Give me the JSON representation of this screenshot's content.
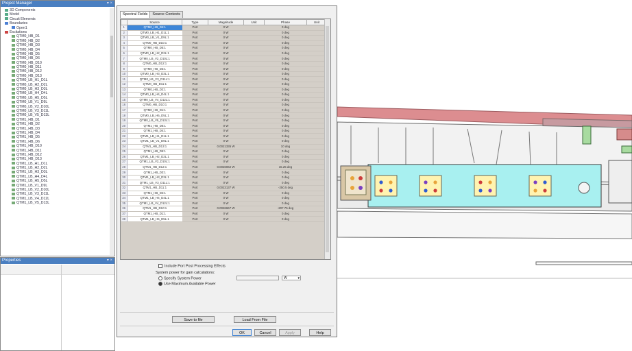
{
  "project_manager": {
    "title": "Project Manager",
    "tree": [
      {
        "label": "3D Components",
        "kind": "comp"
      },
      {
        "label": "Model",
        "kind": "comp"
      },
      {
        "label": "Circuit Elements",
        "kind": "comp"
      },
      {
        "label": "Boundaries",
        "kind": "bnd"
      },
      {
        "label": "Open1",
        "kind": "bnd"
      },
      {
        "label": "Excitations",
        "kind": "exc"
      },
      {
        "label": "QTM0_HB_D1",
        "kind": "port"
      },
      {
        "label": "QTM0_HB_D2",
        "kind": "port"
      },
      {
        "label": "QTM0_HB_D3",
        "kind": "port"
      },
      {
        "label": "QTM0_HB_D4",
        "kind": "port"
      },
      {
        "label": "QTM0_HB_D5",
        "kind": "port"
      },
      {
        "label": "QTM0_HB_D6",
        "kind": "port"
      },
      {
        "label": "QTM0_HB_D10",
        "kind": "port"
      },
      {
        "label": "QTM0_HB_D11",
        "kind": "port"
      },
      {
        "label": "QTM0_HB_D12",
        "kind": "port"
      },
      {
        "label": "QTM0_HB_D13",
        "kind": "port"
      },
      {
        "label": "QTM0_LB_H1_D1L",
        "kind": "port"
      },
      {
        "label": "QTM0_LB_H2_D2L",
        "kind": "port"
      },
      {
        "label": "QTM0_LB_H3_D3L",
        "kind": "port"
      },
      {
        "label": "QTM0_LB_H4_D4L",
        "kind": "port"
      },
      {
        "label": "QTM0_LB_H5_D5L",
        "kind": "port"
      },
      {
        "label": "QTM0_LB_V1_D9L",
        "kind": "port"
      },
      {
        "label": "QTM0_LB_V2_D10L",
        "kind": "port"
      },
      {
        "label": "QTM0_LB_V3_D11L",
        "kind": "port"
      },
      {
        "label": "QTM0_LB_V5_D13L",
        "kind": "port"
      },
      {
        "label": "QTM1_HB_D1",
        "kind": "port"
      },
      {
        "label": "QTM1_HB_D2",
        "kind": "port"
      },
      {
        "label": "QTM1_HB_D3",
        "kind": "port"
      },
      {
        "label": "QTM1_HB_D4",
        "kind": "port"
      },
      {
        "label": "QTM1_HB_D5",
        "kind": "port"
      },
      {
        "label": "QTM1_HB_D6",
        "kind": "port"
      },
      {
        "label": "QTM1_HB_D10",
        "kind": "port"
      },
      {
        "label": "QTM1_HB_D11",
        "kind": "port"
      },
      {
        "label": "QTM1_HB_D12",
        "kind": "port"
      },
      {
        "label": "QTM1_HB_D13",
        "kind": "port"
      },
      {
        "label": "QTM1_LB_H1_D1L",
        "kind": "port"
      },
      {
        "label": "QTM1_LB_H2_D2L",
        "kind": "port"
      },
      {
        "label": "QTM1_LB_H3_D3L",
        "kind": "port"
      },
      {
        "label": "QTM1_LB_H4_D4L",
        "kind": "port"
      },
      {
        "label": "QTM1_LB_H5_D5L",
        "kind": "port"
      },
      {
        "label": "QTM1_LB_V1_D9L",
        "kind": "port"
      },
      {
        "label": "QTM1_LB_V2_D10L",
        "kind": "port"
      },
      {
        "label": "QTM1_LB_V3_D11L",
        "kind": "port"
      },
      {
        "label": "QTM1_LB_V4_D12L",
        "kind": "port"
      },
      {
        "label": "QTM1_LB_V5_D13L",
        "kind": "port"
      }
    ]
  },
  "properties": {
    "title": "Properties"
  },
  "dialog": {
    "tabs": [
      "Spectral Fields",
      "Source Contexts"
    ],
    "columns": [
      "",
      "Source",
      "Type",
      "Magnitude",
      "Unit",
      "Phase",
      "Unit"
    ],
    "rows": [
      {
        "num": "1",
        "source": "QTM0_HB_D4:1",
        "type": "Port",
        "mag": "0 W",
        "phase": "0 deg"
      },
      {
        "num": "2",
        "source": "QTM0_LB_H1_D1L:1",
        "type": "Port",
        "mag": "0 W",
        "phase": "0 deg"
      },
      {
        "num": "3",
        "source": "QTM0_LB_V1_D9L:1",
        "type": "Port",
        "mag": "0 W",
        "phase": "0 deg"
      },
      {
        "num": "4",
        "source": "QTM0_HB_D10:1",
        "type": "Port",
        "mag": "0 W",
        "phase": "0 deg"
      },
      {
        "num": "5",
        "source": "QTM0_HB_D5:1",
        "type": "Port",
        "mag": "0 W",
        "phase": "0 deg"
      },
      {
        "num": "6",
        "source": "QTM0_LB_H2_D2L:1",
        "type": "Port",
        "mag": "0 W",
        "phase": "0 deg"
      },
      {
        "num": "7",
        "source": "QTM0_LB_V2_D10L:1",
        "type": "Port",
        "mag": "0 W",
        "phase": "0 deg"
      },
      {
        "num": "8",
        "source": "QTM0_HB_D12:1",
        "type": "Port",
        "mag": "0 W",
        "phase": "0 deg"
      },
      {
        "num": "9",
        "source": "QTM0_HB_D3:1",
        "type": "Port",
        "mag": "0 W",
        "phase": "0 deg"
      },
      {
        "num": "10",
        "source": "QTM0_LB_H3_D3L:1",
        "type": "Port",
        "mag": "0 W",
        "phase": "0 deg"
      },
      {
        "num": "11",
        "source": "QTM0_LB_V3_D11L:1",
        "type": "Port",
        "mag": "0 W",
        "phase": "0 deg"
      },
      {
        "num": "12",
        "source": "QTM0_HB_D11:1",
        "type": "Port",
        "mag": "0 W",
        "phase": "0 deg"
      },
      {
        "num": "13",
        "source": "QTM0_HB_D2:1",
        "type": "Port",
        "mag": "0 W",
        "phase": "0 deg"
      },
      {
        "num": "14",
        "source": "QTM0_LB_H4_D4L:1",
        "type": "Port",
        "mag": "0 W",
        "phase": "0 deg"
      },
      {
        "num": "15",
        "source": "QTM0_LB_V4_D12L:1",
        "type": "Port",
        "mag": "0 W",
        "phase": "0 deg"
      },
      {
        "num": "16",
        "source": "QTM0_HB_D10:1",
        "type": "Port",
        "mag": "0 W",
        "phase": "0 deg"
      },
      {
        "num": "17",
        "source": "QTM0_HB_D1:1",
        "type": "Port",
        "mag": "0 W",
        "phase": "0 deg"
      },
      {
        "num": "18",
        "source": "QTM0_LB_H5_D5L:1",
        "type": "Port",
        "mag": "0 W",
        "phase": "0 deg"
      },
      {
        "num": "19",
        "source": "QTM0_LB_V5_D13L:1",
        "type": "Port",
        "mag": "0 W",
        "phase": "0 deg"
      },
      {
        "num": "20",
        "source": "QTM1_HB_D6:1",
        "type": "Port",
        "mag": "0 W",
        "phase": "0 deg"
      },
      {
        "num": "21",
        "source": "QTM1_HB_D4:1",
        "type": "Port",
        "mag": "0 W",
        "phase": "0 deg"
      },
      {
        "num": "22",
        "source": "QTM1_LB_H1_D1L:1",
        "type": "Port",
        "mag": "0 W",
        "phase": "0 deg"
      },
      {
        "num": "23",
        "source": "QTM1_LB_V1_D9L:1",
        "type": "Port",
        "mag": "0 W",
        "phase": "0 deg"
      },
      {
        "num": "24",
        "source": "QTM1_HB_D13:1",
        "type": "Port",
        "mag": "0.0021335 W",
        "phase": "10 deg"
      },
      {
        "num": "25",
        "source": "QTM1_HB_D5:1",
        "type": "Port",
        "mag": "0 W",
        "phase": "0 deg"
      },
      {
        "num": "26",
        "source": "QTM1_LB_H2_D2L:1",
        "type": "Port",
        "mag": "0 W",
        "phase": "0 deg"
      },
      {
        "num": "27",
        "source": "QTM1_LB_V2_D10L:1",
        "type": "Port",
        "mag": "0 W",
        "phase": "0 deg"
      },
      {
        "num": "28",
        "source": "QTM1_HB_D12:1",
        "type": "Port",
        "mag": "0.0026062 W",
        "phase": "15.25 deg"
      },
      {
        "num": "29",
        "source": "QTM1_HB_D3:1",
        "type": "Port",
        "mag": "0 W",
        "phase": "0 deg"
      },
      {
        "num": "30",
        "source": "QTM1_LB_H3_D3L:1",
        "type": "Port",
        "mag": "0 W",
        "phase": "0 deg"
      },
      {
        "num": "31",
        "source": "QTM1_LB_V3_D11L:1",
        "type": "Port",
        "mag": "0 W",
        "phase": "0 deg"
      },
      {
        "num": "32",
        "source": "QTM1_HB_D11:1",
        "type": "Port",
        "mag": "0.0023137 W",
        "phase": "-250.5 deg"
      },
      {
        "num": "33",
        "source": "QTM1_HB_D2:1",
        "type": "Port",
        "mag": "0 W",
        "phase": "0 deg"
      },
      {
        "num": "34",
        "source": "QTM1_LB_H4_D4L:1",
        "type": "Port",
        "mag": "0 W",
        "phase": "0 deg"
      },
      {
        "num": "35",
        "source": "QTM1_LB_V4_D12L:1",
        "type": "Port",
        "mag": "0 W",
        "phase": "0 deg"
      },
      {
        "num": "36",
        "source": "QTM1_HB_D10:1",
        "type": "Port",
        "mag": "0.0026667 W",
        "phase": "-207.75 deg"
      },
      {
        "num": "37",
        "source": "QTM1_HB_D1:1",
        "type": "Port",
        "mag": "0 W",
        "phase": "0 deg"
      },
      {
        "num": "38",
        "source": "QTM1_LB_H5_D5L:1",
        "type": "Port",
        "mag": "0 W",
        "phase": "0 deg"
      }
    ],
    "include_post": "Include Port Post Processing Effects",
    "power_label": "System power for gain calculations:",
    "opt_specify": "Specify System Power",
    "opt_use_max": "Use Maximum Available Power",
    "power_unit": "W",
    "save_btn": "Save to file",
    "load_btn": "Load From File",
    "ok_btn": "OK",
    "cancel_btn": "Cancel",
    "apply_btn": "Apply",
    "help_btn": "Help"
  },
  "colors": {
    "selection": "#3d86d8",
    "port_face": "#a8f0f0"
  }
}
